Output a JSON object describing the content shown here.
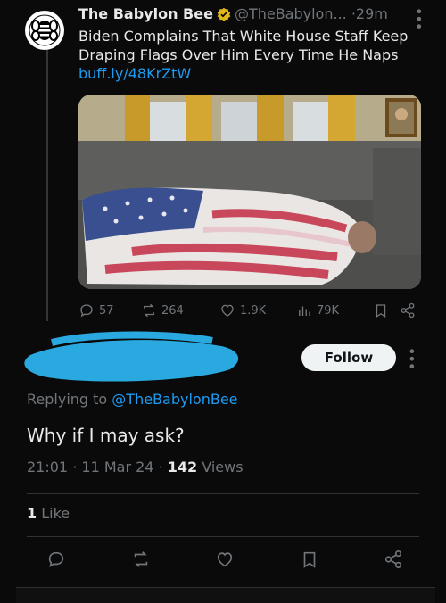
{
  "original_tweet": {
    "author_name": "The Babylon Bee",
    "handle": "@TheBabylon...",
    "separator": "·",
    "time": "29m",
    "text": "Biden Complains That White House Staff Keep Draping Flags Over Him Every Time He Naps",
    "link": "buff.ly/48KrZtW",
    "stats": {
      "replies": "57",
      "reposts": "264",
      "likes": "1.9K",
      "views": "79K"
    }
  },
  "reply_tweet": {
    "follow_label": "Follow",
    "replying_prefix": "Replying to",
    "replying_to": "@TheBabylonBee",
    "text": "Why if I may ask?",
    "time": "21:01",
    "date": "11 Mar 24",
    "separator": "·",
    "views_count": "142",
    "views_label": "Views",
    "likes_count": "1",
    "likes_label": "Like"
  },
  "colors": {
    "accent": "#1d9bf0",
    "muted": "#71767b",
    "redaction": "#29a9e0"
  },
  "icons": {
    "top_bar": [
      "reply-icon",
      "repost-icon",
      "like-icon",
      "views-icon",
      "bookmark-icon",
      "share-icon"
    ],
    "bottom_bar": [
      "reply-icon",
      "repost-icon",
      "like-icon",
      "bookmark-icon",
      "share-icon"
    ]
  }
}
